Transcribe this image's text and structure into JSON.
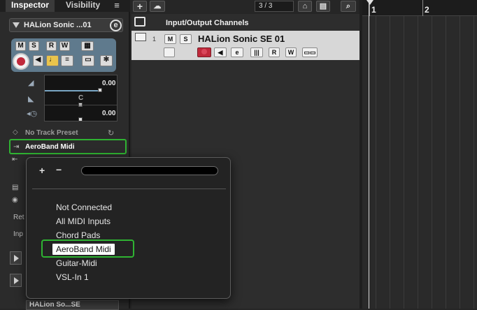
{
  "inspector": {
    "tabs": [
      {
        "label": "Inspector"
      },
      {
        "label": "Visibility"
      }
    ],
    "menu_glyph": "≡",
    "track_name": "HALion Sonic ...01",
    "buttons": {
      "m": "M",
      "s": "S",
      "r": "R",
      "w": "W"
    },
    "volume": "0.00",
    "pan": "C",
    "delay": "0.00",
    "preset": "No Track Preset",
    "midi_input": "AeroBand Midi",
    "side_labels": [
      "Ret",
      "Inp"
    ],
    "bottom_track": "HALion So...SE"
  },
  "toolbar": {
    "counter": "3 / 3",
    "add_glyph": "+"
  },
  "tracklist": {
    "folder": {
      "name": "Input/Output Channels"
    },
    "track": {
      "number": "1",
      "name": "HALion Sonic SE 01",
      "m": "M",
      "s": "S",
      "r": "R",
      "w": "W"
    }
  },
  "ruler": {
    "marks": [
      "1",
      "2"
    ]
  },
  "popup": {
    "add": "+",
    "remove": "−",
    "options": [
      {
        "label": "Not Connected"
      },
      {
        "label": "All MIDI Inputs"
      },
      {
        "label": "Chord Pads"
      },
      {
        "label": "AeroBand Midi",
        "selected": true
      },
      {
        "label": "Guitar-Midi"
      },
      {
        "label": "VSL-In 1"
      }
    ]
  },
  "colors": {
    "highlight": "#2fb332",
    "panel": "#5f7a8d",
    "record": "#c0293b",
    "fader": "#7aa6c4"
  }
}
